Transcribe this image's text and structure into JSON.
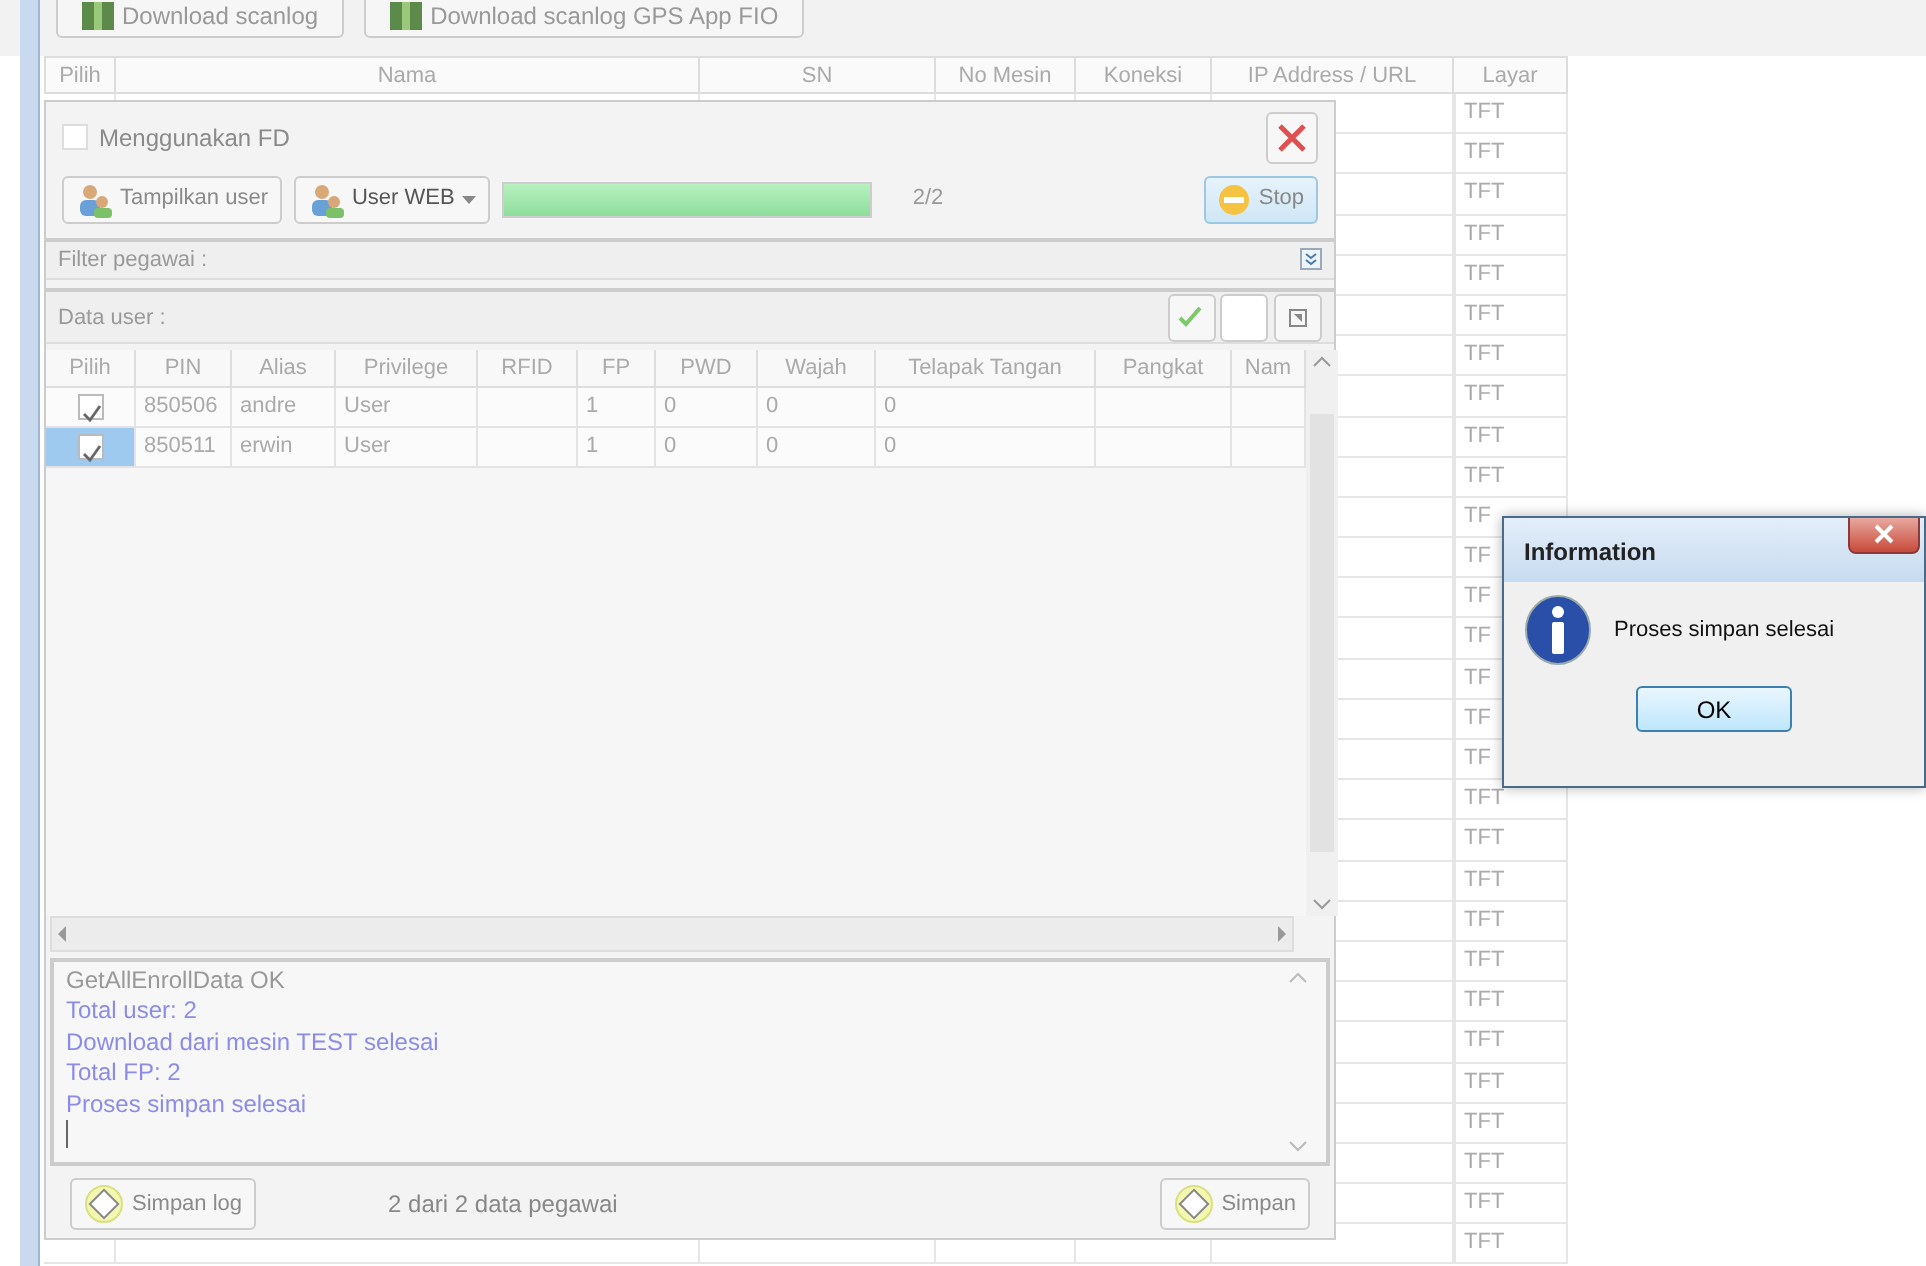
{
  "toolbar": {
    "buttons": [
      {
        "label": "Download scanlog"
      },
      {
        "label": "Download scanlog GPS App FIO"
      }
    ]
  },
  "device_table": {
    "columns": [
      "Pilih",
      "Nama",
      "SN",
      "No Mesin",
      "Koneksi",
      "IP Address / URL",
      "Layar"
    ],
    "rows": [
      "TFT",
      "TFT",
      "TFT",
      "TFT",
      "TFT",
      "TFT",
      "TFT",
      "TFT",
      "TFT",
      "TFT",
      "TF",
      "TF",
      "TF",
      "TF",
      "TF",
      "TF",
      "TF",
      "TFT",
      "TFT",
      "TFT",
      "TFT",
      "TFT",
      "TFT",
      "TFT",
      "TFT",
      "TFT",
      "TFT",
      "TFT",
      "TFT"
    ]
  },
  "user_panel": {
    "use_fd": {
      "label": "Menggunakan FD",
      "checked": false,
      "disabled": true
    },
    "show_users_button": {
      "label": "Tampilkan user",
      "disabled": true
    },
    "web_button": {
      "label": "User WEB",
      "disabled": false
    },
    "progress": {
      "level": 1,
      "reading": "2/2"
    },
    "stop_button": {
      "label": "Stop"
    },
    "filter": {
      "label": "Filter pegawai :"
    },
    "data_user": {
      "label": "Data user :"
    },
    "users": {
      "columns": [
        "Pilih",
        "PIN",
        "Alias",
        "Privilege",
        "RFID",
        "FP",
        "PWD",
        "Wajah",
        "Telapak Tangan",
        "Pangkat",
        "Nam"
      ],
      "rows": [
        {
          "checked": true,
          "selected": false,
          "cells": [
            "",
            "850506",
            "andre",
            "User",
            "",
            "1",
            "0",
            "0",
            "0",
            "",
            ""
          ]
        },
        {
          "checked": true,
          "selected": true,
          "cells": [
            "",
            "850511",
            "erwin",
            "User",
            "",
            "1",
            "0",
            "0",
            "0",
            "",
            ""
          ]
        }
      ]
    },
    "log": [
      {
        "kind": "status",
        "text": "GetAllEnrollData OK"
      },
      {
        "kind": "result",
        "text": "Total user: 2"
      },
      {
        "kind": "result",
        "text": "Download dari mesin TEST selesai"
      },
      {
        "kind": "result",
        "text": "Total FP: 2"
      },
      {
        "kind": "result",
        "text": "Proses simpan selesai"
      }
    ],
    "save_log_button": {
      "label": "Simpan log",
      "disabled": true
    },
    "count": "2 dari 2 data pegawai",
    "save_button": {
      "label": "Simpan",
      "disabled": true
    }
  },
  "dialog": {
    "title": "Information",
    "message": "Proses simpan selesai",
    "button": "OK"
  }
}
